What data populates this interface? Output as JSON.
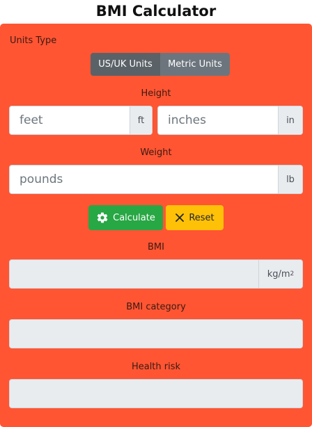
{
  "title": "BMI Calculator",
  "units": {
    "label": "Units Type",
    "options": [
      "US/UK Units",
      "Metric Units"
    ],
    "selected": "US/UK Units"
  },
  "height": {
    "label": "Height",
    "feet_placeholder": "feet",
    "feet_unit": "ft",
    "inches_placeholder": "inches",
    "inches_unit": "in"
  },
  "weight": {
    "label": "Weight",
    "placeholder": "pounds",
    "unit": "lb"
  },
  "actions": {
    "calculate_label": "Calculate",
    "calculate_icon": "gear-icon",
    "reset_label": "Reset",
    "reset_icon": "close-icon"
  },
  "bmi": {
    "label": "BMI",
    "unit": "kg/m",
    "unit_sup": "2"
  },
  "category": {
    "label": "BMI category"
  },
  "risk": {
    "label": "Health risk"
  },
  "colors": {
    "card": "#ff5533",
    "calculate": "#28a745",
    "reset": "#ffc107",
    "toggle_active": "#5a6268",
    "toggle_inactive": "#6c757d"
  }
}
